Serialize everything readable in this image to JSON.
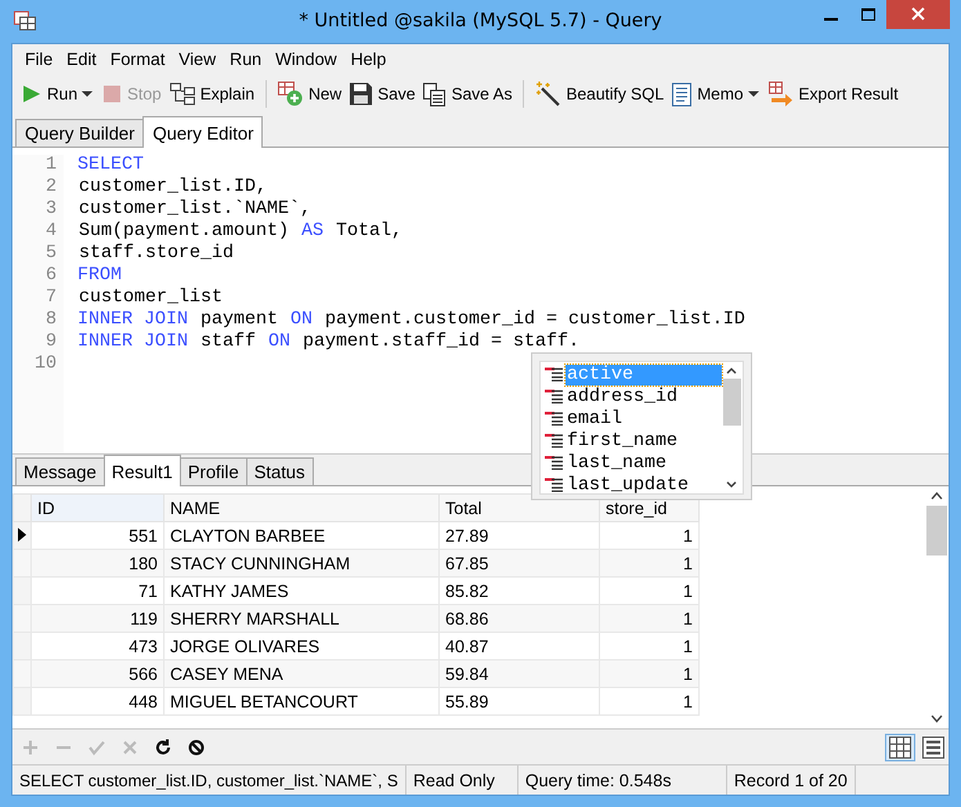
{
  "window": {
    "title": "* Untitled @sakila (MySQL 5.7) - Query"
  },
  "menu": [
    "File",
    "Edit",
    "Format",
    "View",
    "Run",
    "Window",
    "Help"
  ],
  "toolbar": [
    {
      "kind": "run",
      "label": "Run",
      "dropdown": true,
      "disabled": false
    },
    {
      "kind": "stop",
      "label": "Stop",
      "dropdown": false,
      "disabled": true
    },
    {
      "kind": "explain",
      "label": "Explain",
      "dropdown": false,
      "disabled": false
    },
    {
      "kind": "separator"
    },
    {
      "kind": "new",
      "label": "New",
      "dropdown": false,
      "disabled": false
    },
    {
      "kind": "save",
      "label": "Save",
      "dropdown": false,
      "disabled": false
    },
    {
      "kind": "saveas",
      "label": "Save As",
      "dropdown": false,
      "disabled": false
    },
    {
      "kind": "separator"
    },
    {
      "kind": "beautify",
      "label": "Beautify SQL",
      "dropdown": false,
      "disabled": false
    },
    {
      "kind": "memo",
      "label": "Memo",
      "dropdown": true,
      "disabled": false
    },
    {
      "kind": "export",
      "label": "Export Result",
      "dropdown": false,
      "disabled": false
    }
  ],
  "editor_tabs": [
    {
      "label": "Query Builder",
      "selected": false
    },
    {
      "label": "Query Editor",
      "selected": true
    }
  ],
  "editor": {
    "lines": [
      {
        "number": "1",
        "tokens": [
          {
            "text": "SELECT",
            "keyword": true
          }
        ]
      },
      {
        "number": "2",
        "tokens": [
          {
            "text": "customer_list.ID,",
            "keyword": false
          }
        ]
      },
      {
        "number": "3",
        "tokens": [
          {
            "text": "customer_list.`NAME`,",
            "keyword": false
          }
        ]
      },
      {
        "number": "4",
        "tokens": [
          {
            "text": "Sum(payment.amount)",
            "keyword": false
          },
          {
            "text": "AS",
            "keyword": true
          },
          {
            "text": "Total,",
            "keyword": false
          }
        ]
      },
      {
        "number": "5",
        "tokens": [
          {
            "text": "staff.store_id",
            "keyword": false
          }
        ]
      },
      {
        "number": "6",
        "tokens": [
          {
            "text": "FROM",
            "keyword": true
          }
        ]
      },
      {
        "number": "7",
        "tokens": [
          {
            "text": "customer_list",
            "keyword": false
          }
        ]
      },
      {
        "number": "8",
        "tokens": [
          {
            "text": "INNER JOIN",
            "keyword": true
          },
          {
            "text": "payment",
            "keyword": false
          },
          {
            "text": "ON",
            "keyword": true
          },
          {
            "text": "payment.customer_id = customer_list.ID",
            "keyword": false
          }
        ]
      },
      {
        "number": "9",
        "tokens": [
          {
            "text": "INNER JOIN",
            "keyword": true
          },
          {
            "text": "staff",
            "keyword": false
          },
          {
            "text": "ON",
            "keyword": true
          },
          {
            "text": "payment.staff_id = staff.",
            "keyword": false
          }
        ]
      },
      {
        "number": "10"
      }
    ]
  },
  "autocomplete": {
    "items": [
      {
        "label": "active",
        "selected": true
      },
      {
        "label": "address_id",
        "selected": false
      },
      {
        "label": "email",
        "selected": false
      },
      {
        "label": "first_name",
        "selected": false
      },
      {
        "label": "last_name",
        "selected": false
      },
      {
        "label": "last_update",
        "selected": false
      }
    ]
  },
  "result_tabs": [
    {
      "label": "Message",
      "selected": false
    },
    {
      "label": "Result1",
      "selected": true
    },
    {
      "label": "Profile",
      "selected": false
    },
    {
      "label": "Status",
      "selected": false
    }
  ],
  "grid": {
    "columns": [
      "ID",
      "NAME",
      "Total",
      "store_id"
    ],
    "rows": [
      {
        "cells": [
          "551",
          "CLAYTON BARBEE",
          "27.89",
          "1"
        ],
        "current": true
      },
      {
        "cells": [
          "180",
          "STACY CUNNINGHAM",
          "67.85",
          "1"
        ],
        "current": false
      },
      {
        "cells": [
          "71",
          "KATHY JAMES",
          "85.82",
          "1"
        ],
        "current": false
      },
      {
        "cells": [
          "119",
          "SHERRY MARSHALL",
          "68.86",
          "1"
        ],
        "current": false
      },
      {
        "cells": [
          "473",
          "JORGE OLIVARES",
          "40.87",
          "1"
        ],
        "current": false
      },
      {
        "cells": [
          "566",
          "CASEY MENA",
          "59.84",
          "1"
        ],
        "current": false
      },
      {
        "cells": [
          "448",
          "MIGUEL BETANCOURT",
          "55.89",
          "1"
        ],
        "current": false
      }
    ]
  },
  "grid_actions": [
    {
      "kind": "add",
      "disabled": true
    },
    {
      "kind": "remove",
      "disabled": true
    },
    {
      "kind": "apply",
      "disabled": true
    },
    {
      "kind": "discard",
      "disabled": true
    },
    {
      "kind": "refresh",
      "disabled": false
    },
    {
      "kind": "stop",
      "disabled": false
    }
  ],
  "view_modes": [
    {
      "kind": "grid",
      "selected": true
    },
    {
      "kind": "form",
      "selected": false
    }
  ],
  "status_bar": [
    "SELECT customer_list.ID, customer_list.`NAME`, S",
    "Read Only",
    "Query time: 0.548s",
    "Record 1 of 20"
  ]
}
